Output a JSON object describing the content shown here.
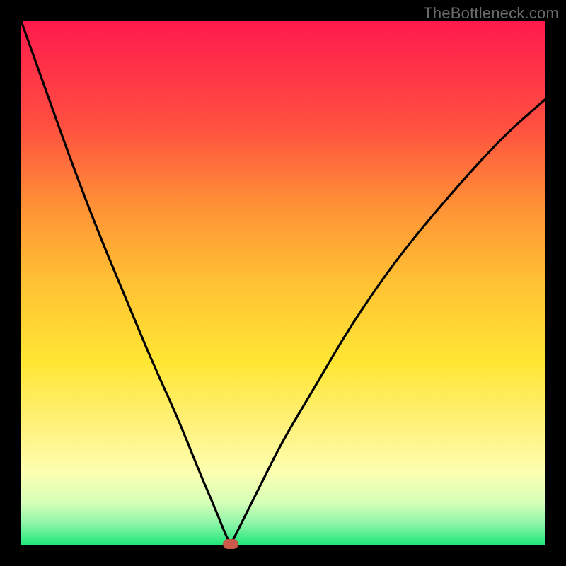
{
  "watermark": "TheBottleneck.com",
  "chart_data": {
    "type": "line",
    "title": "",
    "xlabel": "",
    "ylabel": "",
    "xlim": [
      0,
      100
    ],
    "ylim": [
      0,
      100
    ],
    "grid": false,
    "legend": false,
    "description": "V-shaped bottleneck curve over a red-to-green vertical gradient; curve minimum touches the bottom edge near x≈40.",
    "series": [
      {
        "name": "bottleneck-curve",
        "color": "#000000",
        "x": [
          0,
          5,
          10,
          15,
          20,
          25,
          30,
          34,
          37,
          39,
          40,
          41,
          43,
          46,
          50,
          56,
          63,
          72,
          82,
          92,
          100
        ],
        "y": [
          100,
          86,
          72,
          59,
          47,
          35,
          24,
          14,
          7,
          2,
          0,
          2,
          6,
          12,
          20,
          30,
          42,
          55,
          67,
          78,
          85
        ]
      }
    ],
    "marker": {
      "x": 40,
      "y": 0,
      "color": "#cc5a4a"
    },
    "gradient_stops": [
      {
        "position": 0,
        "color": "#ff1a4d"
      },
      {
        "position": 50,
        "color": "#ffe633"
      },
      {
        "position": 100,
        "color": "#1fe67a"
      }
    ]
  }
}
